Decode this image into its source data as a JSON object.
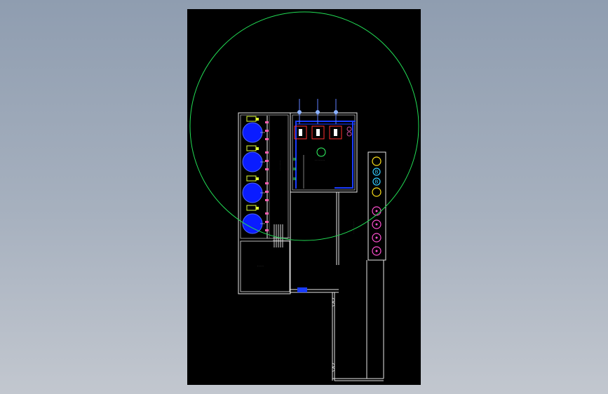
{
  "canvas": {
    "background_top": "#8f9db0",
    "background_bottom": "#c2c7cf",
    "sheet_color": "#000000"
  },
  "colors": {
    "wall": "#e8e8e8",
    "radius_circle": "#22dd55",
    "tank_fill": "#0a1cff",
    "pipe_blue": "#1a3cff",
    "marker_yellow": "#ffe21a",
    "marker_magenta": "#ff4fd0",
    "marker_cyan": "#33ccff",
    "unit_red": "#ff3030",
    "valve_pink": "#ff5fb0",
    "unit_green": "#33ff66"
  },
  "drawing": {
    "coverage_circle": "green-range-circle",
    "storage_tanks_count": 4,
    "pump_units_count": 3,
    "yellow_markers_count": 2,
    "cyan_markers_count": 2,
    "magenta_markers_count": 4,
    "marker_letters": [
      "B",
      "B"
    ]
  }
}
